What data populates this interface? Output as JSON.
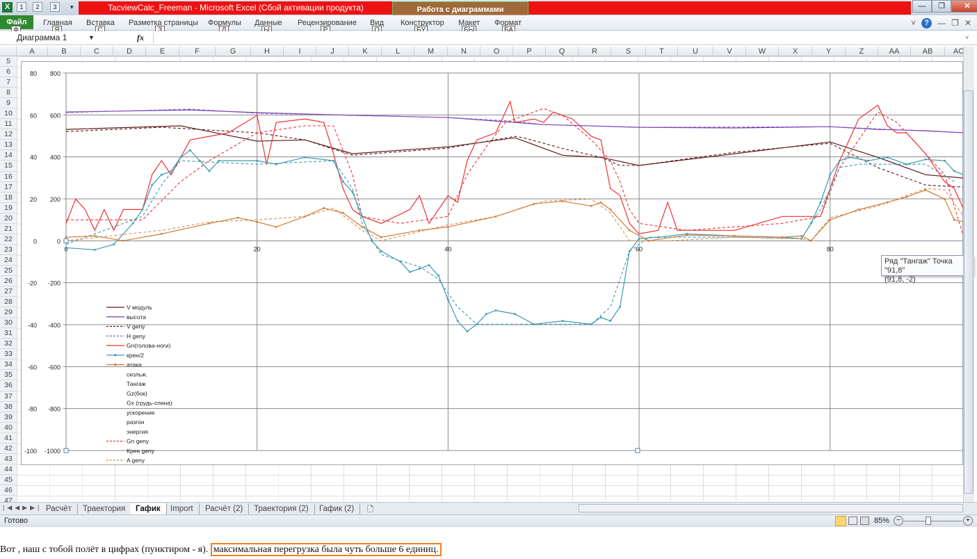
{
  "window": {
    "title": "TacviewCalc_Freeman  -  Microsoft Excel (Сбой активации продукта)",
    "context_group": "Работа с диаграммами",
    "quick_access": [
      "1",
      "2",
      "3"
    ],
    "buttons": [
      "—",
      "❐",
      "✕"
    ]
  },
  "ribbon": {
    "file": "Файл",
    "tabs": [
      {
        "label": "Главная",
        "key": "Я"
      },
      {
        "label": "Вставка",
        "key": "С"
      },
      {
        "label": "Разметка страницы",
        "key": "З"
      },
      {
        "label": "Формулы",
        "key": "Л"
      },
      {
        "label": "Данные",
        "key": "Ы"
      },
      {
        "label": "Рецензирование",
        "key": "Р"
      },
      {
        "label": "Вид",
        "key": "О"
      },
      {
        "label": "Конструктор",
        "key": "БУ"
      },
      {
        "label": "Макет",
        "key": "БЫ"
      },
      {
        "label": "Формат",
        "key": "БА"
      }
    ],
    "file_key": "Ф",
    "right_icons": [
      "˅",
      "?",
      "—",
      "❐",
      "✕"
    ]
  },
  "formula_bar": {
    "name_box": "Диаграмма 1",
    "fx": "fx",
    "value": ""
  },
  "columns": [
    "A",
    "B",
    "C",
    "D",
    "E",
    "F",
    "G",
    "H",
    "I",
    "J",
    "K",
    "L",
    "M",
    "N",
    "O",
    "P",
    "Q",
    "R",
    "S",
    "T",
    "U",
    "V",
    "W",
    "X",
    "Y",
    "Z",
    "AA",
    "AB",
    "AC"
  ],
  "rows": [
    5,
    6,
    7,
    8,
    9,
    10,
    11,
    12,
    13,
    14,
    15,
    16,
    17,
    18,
    19,
    20,
    21,
    22,
    23,
    24,
    25,
    26,
    27,
    28,
    29,
    30,
    31,
    32,
    33,
    34,
    35,
    36,
    37,
    38,
    39,
    40,
    41,
    42,
    43,
    44,
    45,
    46,
    47
  ],
  "sheet_tabs": [
    {
      "label": "Расчёт"
    },
    {
      "label": "Траектория"
    },
    {
      "label": "Гафик",
      "active": true
    },
    {
      "label": "Import"
    },
    {
      "label": "Расчёт (2)"
    },
    {
      "label": "Траектория (2)"
    },
    {
      "label": "Гафик (2)"
    }
  ],
  "status": {
    "ready": "Готово",
    "zoom": "85%"
  },
  "tooltip": {
    "line1": "Ряд \"Тангаж\" Точка \"91,8\"",
    "line2": "(91,8, -2)"
  },
  "caption": {
    "text": "Вот , наш с тобой полёт в цифрах (пунктиром - я). ",
    "highlight": "максимальная перегрузка была чуть больше 6 единиц."
  },
  "chart_data": {
    "type": "line",
    "xlim": [
      0,
      94
    ],
    "ylim": [
      -1000,
      800
    ],
    "y2lim": [
      -100,
      80
    ],
    "xticks": [
      "0",
      "20",
      "40",
      "60",
      "80"
    ],
    "yticks": [
      "800",
      "600",
      "400",
      "200",
      "0",
      "-200",
      "-400",
      "-600",
      "-800",
      "-1000"
    ],
    "y2ticks": [
      "80",
      "60",
      "40",
      "20",
      "0",
      "-20",
      "-40",
      "-60",
      "-80",
      "-100"
    ],
    "legend_position": "left-bottom",
    "legend": [
      {
        "name": "V модуль",
        "color": "#5a1a1a",
        "dash": false
      },
      {
        "name": "высота",
        "color": "#6a3ab0",
        "dash": false
      },
      {
        "name": "V geny",
        "color": "#5a1a1a",
        "dash": true
      },
      {
        "name": "H geny",
        "color": "#9a5ad0",
        "dash": true
      },
      {
        "name": "Gn(голова-ноги)",
        "color": "#f03030",
        "dash": false
      },
      {
        "name": "крен/2",
        "color": "#3a9ab0",
        "dash": false,
        "marker": true
      },
      {
        "name": "атака",
        "color": "#d07a30",
        "dash": false,
        "marker": true
      },
      {
        "name": "скольж.",
        "color": null
      },
      {
        "name": "Тангаж",
        "color": null
      },
      {
        "name": "Gz(бок)",
        "color": null
      },
      {
        "name": "Gx (грудь-спина)",
        "color": null
      },
      {
        "name": "ускорение",
        "color": null
      },
      {
        "name": "разгон",
        "color": null
      },
      {
        "name": "энергия",
        "color": null
      },
      {
        "name": "Gn geny",
        "color": "#f03030",
        "dash": true
      },
      {
        "name": "Крен geny",
        "color": null
      },
      {
        "name": "A geny",
        "color": "#d09060",
        "dash": true
      }
    ],
    "series": [
      {
        "name": "высота",
        "color": "#6a3ab0",
        "dash": false,
        "x": [
          0,
          13,
          20,
          30,
          40,
          50,
          60,
          70,
          80,
          85,
          90,
          94
        ],
        "y": [
          614,
          624,
          611,
          598,
          588,
          554,
          541,
          538,
          544,
          531,
          525,
          515
        ]
      },
      {
        "name": "H geny",
        "color": "#9a5ad0",
        "dash": true,
        "x": [
          0,
          13,
          20,
          30,
          40,
          47,
          50,
          60,
          80,
          94
        ],
        "y": [
          611,
          628,
          608,
          598,
          588,
          570,
          554,
          541,
          544,
          515
        ]
      },
      {
        "name": "V модуль",
        "color": "#5a1a1a",
        "dash": false,
        "x": [
          0,
          12,
          15,
          20,
          25,
          30,
          40,
          47,
          52,
          56,
          60,
          70,
          80,
          85,
          90,
          94
        ],
        "y": [
          531,
          548,
          521,
          475,
          481,
          415,
          448,
          491,
          408,
          398,
          359,
          415,
          471,
          398,
          315,
          299
        ]
      },
      {
        "name": "V geny",
        "color": "#5a1a1a",
        "dash": true,
        "x": [
          0,
          10,
          20,
          25,
          30,
          40,
          47,
          48,
          52,
          56,
          58,
          60,
          70,
          80,
          85,
          90,
          94
        ],
        "y": [
          521,
          541,
          515,
          481,
          408,
          442,
          498,
          490,
          440,
          398,
          359,
          359,
          422,
          465,
          349,
          266,
          256
        ]
      },
      {
        "name": "Gn geny",
        "color": "#f03030",
        "dash": true,
        "x": [
          0,
          8,
          12,
          15,
          20,
          25,
          28,
          30,
          31,
          35,
          40,
          42,
          44,
          46,
          50,
          52,
          55,
          57,
          58,
          59,
          60,
          65,
          75,
          79,
          81,
          83,
          85,
          87,
          90,
          92,
          94
        ],
        "y": [
          100,
          100,
          282,
          382,
          515,
          548,
          548,
          315,
          116,
          83,
          116,
          315,
          448,
          564,
          631,
          598,
          481,
          382,
          282,
          149,
          83,
          50,
          83,
          116,
          349,
          481,
          614,
          564,
          415,
          315,
          17
        ]
      },
      {
        "name": "Gn(голова-ноги)",
        "color": "#f03030",
        "dash": false,
        "x": [
          0,
          1,
          2,
          3,
          4,
          5,
          6,
          8,
          9,
          10,
          11,
          13,
          15,
          17,
          20,
          21,
          22,
          25,
          27,
          28,
          29,
          30,
          31,
          33,
          36,
          37,
          38,
          40,
          41,
          42,
          43,
          45,
          46,
          46.5,
          47,
          49,
          50,
          51,
          53,
          55,
          56,
          57,
          58,
          59,
          60,
          62,
          63,
          64,
          70,
          75,
          79,
          80,
          81,
          82,
          83,
          84,
          85,
          86,
          87,
          88,
          90,
          91,
          92,
          93,
          94
        ],
        "y": [
          83,
          199,
          149,
          50,
          149,
          50,
          149,
          149,
          315,
          382,
          315,
          481,
          498,
          515,
          598,
          365,
          564,
          581,
          564,
          415,
          249,
          149,
          116,
          83,
          149,
          216,
          83,
          216,
          183,
          382,
          481,
          515,
          614,
          664,
          564,
          581,
          564,
          614,
          581,
          498,
          481,
          249,
          216,
          83,
          33,
          50,
          183,
          50,
          50,
          116,
          116,
          249,
          382,
          481,
          581,
          614,
          647,
          548,
          515,
          515,
          415,
          349,
          282,
          249,
          149
        ]
      },
      {
        "name": "Крен geny",
        "color": "#3a9ab0",
        "dash": true,
        "x": [
          0,
          8,
          10,
          12,
          20,
          28,
          30,
          31,
          33,
          36,
          37,
          39,
          41,
          43,
          50,
          55,
          57,
          58,
          59,
          61,
          70,
          77,
          79,
          81,
          83,
          90,
          93
        ],
        "y": [
          -17,
          116,
          266,
          382,
          365,
          382,
          249,
          83,
          -66,
          -110,
          -123,
          -183,
          -315,
          -398,
          -398,
          -398,
          -315,
          -183,
          -50,
          17,
          17,
          10,
          149,
          349,
          365,
          365,
          282
        ]
      },
      {
        "name": "крен/2",
        "color": "#3a9ab0",
        "dash": false,
        "marker": true,
        "x": [
          0,
          3,
          5,
          7,
          8,
          9,
          10,
          11,
          12,
          13,
          14,
          15,
          16,
          20,
          22,
          25,
          28,
          29,
          30,
          31,
          32,
          33,
          35,
          36,
          37,
          38,
          39,
          40,
          41,
          42,
          43,
          44,
          45,
          47,
          49,
          52,
          55,
          56,
          57,
          58,
          59,
          60,
          62,
          65,
          70,
          75,
          77,
          78,
          79,
          80,
          81,
          82,
          84,
          86,
          88,
          90,
          92,
          93,
          94
        ],
        "y": [
          -33,
          -43,
          -17,
          83,
          149,
          266,
          315,
          332,
          398,
          432,
          382,
          332,
          382,
          382,
          365,
          398,
          382,
          282,
          232,
          116,
          0,
          -50,
          -100,
          -149,
          -133,
          -116,
          -166,
          -282,
          -382,
          -432,
          -398,
          -349,
          -332,
          -349,
          -398,
          -382,
          -398,
          -365,
          -382,
          -315,
          -50,
          10,
          17,
          33,
          23,
          17,
          10,
          83,
          183,
          315,
          382,
          398,
          382,
          398,
          365,
          388,
          382,
          332,
          315
        ]
      },
      {
        "name": "A geny",
        "color": "#d09060",
        "dash": true,
        "x": [
          0,
          10,
          15,
          20,
          25,
          28,
          31,
          33,
          40,
          45,
          50,
          55,
          57,
          59,
          63,
          70,
          77,
          78,
          80,
          85,
          90,
          92,
          94
        ],
        "y": [
          0,
          50,
          90,
          100,
          116,
          156,
          50,
          0,
          76,
          116,
          189,
          199,
          133,
          0,
          0,
          17,
          10,
          0,
          110,
          166,
          249,
          242,
          116
        ]
      },
      {
        "name": "атака",
        "color": "#d07a30",
        "dash": false,
        "marker": true,
        "x": [
          0,
          3,
          6,
          10,
          15,
          18,
          20,
          22,
          25,
          27,
          29,
          31,
          33,
          37,
          40,
          45,
          49,
          52,
          55,
          56,
          57,
          59,
          61,
          65,
          70,
          75,
          77,
          78,
          80,
          83,
          86,
          88,
          90,
          92,
          93,
          94
        ],
        "y": [
          17,
          23,
          0,
          33,
          83,
          110,
          90,
          66,
          116,
          156,
          133,
          66,
          17,
          50,
          66,
          116,
          176,
          189,
          166,
          183,
          149,
          50,
          0,
          27,
          23,
          17,
          23,
          0,
          100,
          149,
          183,
          209,
          242,
          199,
          100,
          90
        ]
      }
    ]
  }
}
